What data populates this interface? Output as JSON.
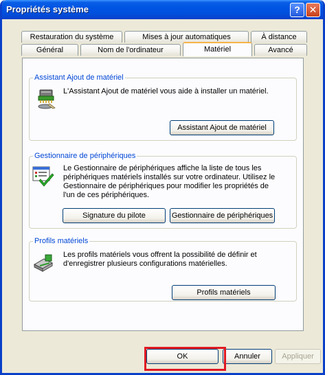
{
  "window": {
    "title": "Propriétés système"
  },
  "titlebar_buttons": {
    "help": "?",
    "close": "✕"
  },
  "tabs": {
    "row1": [
      "Restauration du système",
      "Mises à jour automatiques",
      "À distance"
    ],
    "row2": [
      "Général",
      "Nom de l'ordinateur",
      "Matériel",
      "Avancé"
    ],
    "active": "Matériel"
  },
  "groups": {
    "assistant": {
      "title": "Assistant Ajout de matériel",
      "description": "L'Assistant Ajout de matériel vous aide à installer un matériel.",
      "button": "Assistant Ajout de matériel"
    },
    "gestionnaire": {
      "title": "Gestionnaire de périphériques",
      "description_lines": [
        "Le Gestionnaire de périphériques affiche la liste de tous les",
        "périphériques matériels installés sur votre ordinateur. Utilisez le",
        "Gestionnaire de périphériques pour modifier les propriétés de",
        "l'un de ces périphériques."
      ],
      "button_signature": "Signature du pilote",
      "button_manager": "Gestionnaire de périphériques"
    },
    "profils": {
      "title": "Profils matériels",
      "description_lines": [
        "Les profils matériels vous offrent la possibilité de définir et",
        "d'enregistrer plusieurs configurations matérielles."
      ],
      "button": "Profils matériels"
    }
  },
  "footer": {
    "ok": "OK",
    "cancel": "Annuler",
    "apply": "Appliquer"
  }
}
